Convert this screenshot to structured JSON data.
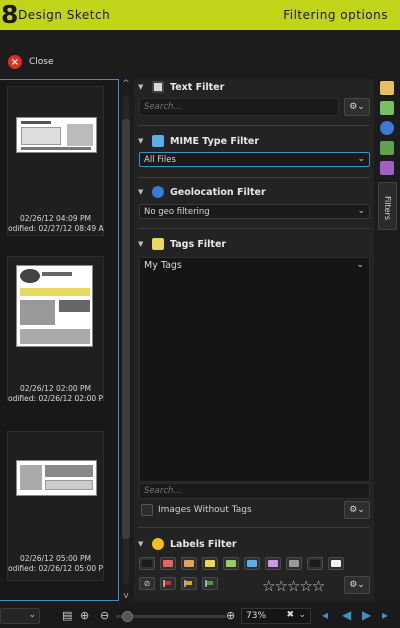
{
  "header": {
    "logo_glyph": "8",
    "app_title": "Design Sketch",
    "options_title": "Filtering options",
    "bg_color": "#c2d41a"
  },
  "close": {
    "label": "Close",
    "icon": "close-circle-icon"
  },
  "thumbnails": [
    {
      "date": "02/26/12 04:09 PM",
      "modified": "odified: 02/27/12 08:49 A"
    },
    {
      "date": "02/26/12 02:00 PM",
      "modified": "odified: 02/26/12 02:00 P"
    },
    {
      "date": "02/26/12 05:00 PM",
      "modified": "odified: 02/26/12 05:00 P"
    }
  ],
  "filters": {
    "text": {
      "title": "Text Filter",
      "placeholder": "Search..."
    },
    "mime": {
      "title": "MIME Type Filter",
      "value": "All Files"
    },
    "geo": {
      "title": "Geolocation Filter",
      "value": "No geo filtering"
    },
    "tags": {
      "title": "Tags Filter",
      "value": "My Tags",
      "search_placeholder": "Search...",
      "without_tags_label": "Images Without Tags"
    },
    "labels": {
      "title": "Labels Filter",
      "colors": [
        "#1a1a1a",
        "#e06666",
        "#e6a05a",
        "#e8d860",
        "#9ccc65",
        "#5ab0e6",
        "#c89ae6",
        "#9a9a9a",
        "#1a1a1a",
        "#f4f4f4"
      ],
      "flag_colors": [
        "#c03030",
        "#e0a020",
        "#40a040"
      ],
      "stars": "☆☆☆☆☆"
    }
  },
  "right_tab": {
    "label": "Filters"
  },
  "status": {
    "zoom": "73%",
    "accent": "#3a93c6"
  }
}
